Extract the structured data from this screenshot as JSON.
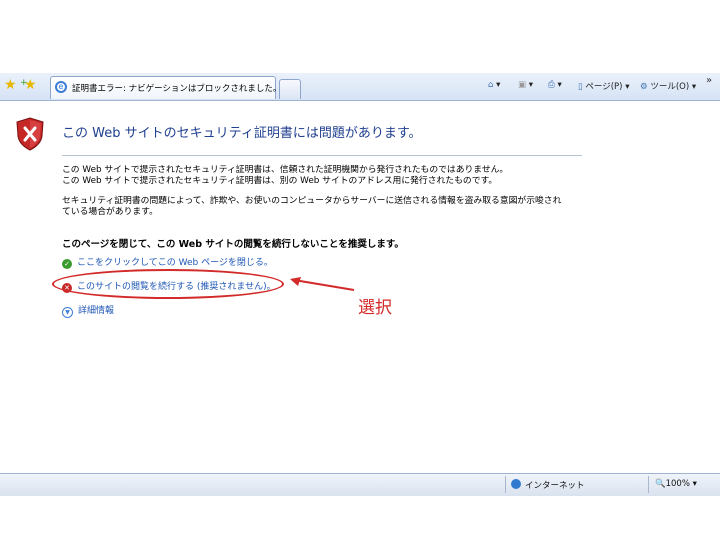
{
  "browser": {
    "tab_title": "証明書エラー: ナビゲーションはブロックされました。",
    "menu_page": "ページ(P)",
    "menu_tools": "ツール(O)",
    "more": "»",
    "dropdown": "▾"
  },
  "page": {
    "heading": "この Web サイトのセキュリティ証明書には問題があります。",
    "para1_line1": "この Web サイトで提示されたセキュリティ証明書は、信頼された証明機関から発行されたものではありません。",
    "para1_line2": "この Web サイトで提示されたセキュリティ証明書は、別の Web サイトのアドレス用に発行されたものです。",
    "para2_line1": "セキュリティ証明書の問題によって、詐欺や、お使いのコンピュータからサーバーに送信される情報を盗み取る意図が示唆され",
    "para2_line2": "ている場合があります。",
    "recommend": "このページを閉じて、この Web サイトの閲覧を続行しないことを推奨します。",
    "link_close": "ここをクリックしてこの Web ページを閉じる。",
    "link_continue": "このサイトの閲覧を続行する (推奨されません)。",
    "link_details": "詳細情報"
  },
  "annotation": {
    "label": "選択",
    "color": "#d32a2a"
  },
  "statusbar": {
    "zone": "インターネット",
    "zoom": "100%"
  }
}
